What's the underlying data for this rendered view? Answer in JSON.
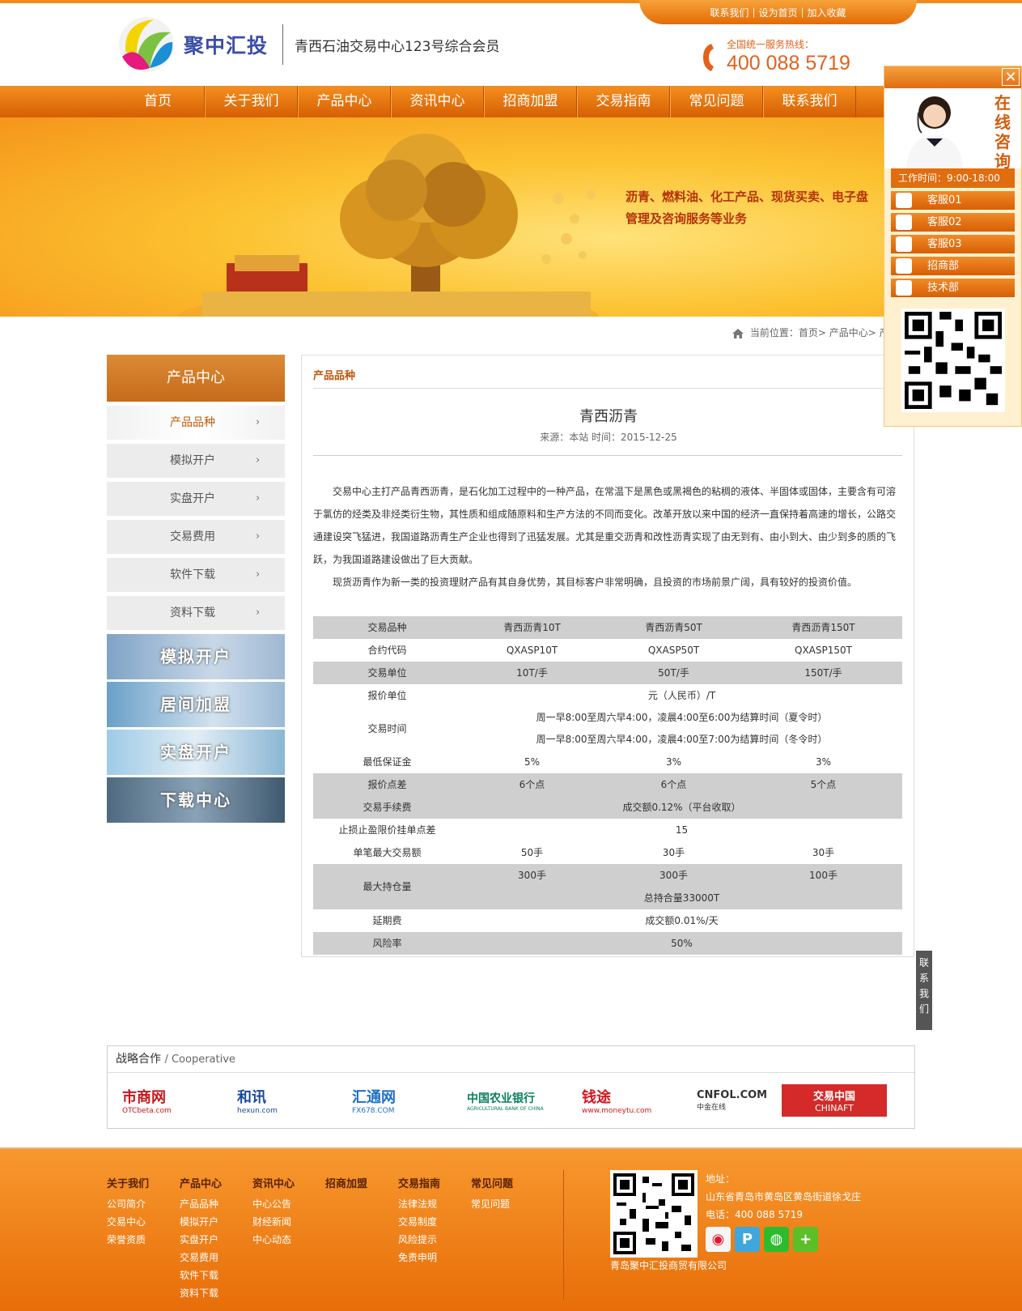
{
  "header": {
    "top_links": [
      "联系我们",
      "设为首页",
      "加入收藏"
    ],
    "brand_name": "聚中汇投",
    "slogan": "青西石油交易中心123号综合会员",
    "hotline_label": "全国统一服务热线：",
    "hotline_number": "400 088 5719"
  },
  "nav": [
    "首页",
    "关于我们",
    "产品中心",
    "资讯中心",
    "招商加盟",
    "交易指南",
    "常见问题",
    "联系我们"
  ],
  "banner": {
    "line1": "沥青、燃料油、化工产品、现货买卖、电子盘",
    "line2": "管理及咨询服务等业务"
  },
  "breadcrumb": "当前位置：首页> 产品中心> 产品品种",
  "sidebar": {
    "title": "产品中心",
    "items": [
      "产品品种",
      "模拟开户",
      "实盘开户",
      "交易费用",
      "软件下载",
      "资料下载"
    ],
    "promos": [
      "模拟开户",
      "居间加盟",
      "实盘开户",
      "下载中心"
    ]
  },
  "article": {
    "category": "产品品种",
    "title": "青西沥青",
    "meta": "来源：本站 时间：2015-12-25",
    "paragraphs": [
      "交易中心主打产品青西沥青，是石化加工过程中的一种产品，在常温下是黑色或黑褐色的粘稠的液体、半固体或固体，主要含有可溶于氯仿的烃类及非烃类衍生物，其性质和组成随原料和生产方法的不同而变化。改革开放以来中国的经济一直保持着高速的增长，公路交通建设突飞猛进，我国道路沥青生产企业也得到了迅猛发展。尤其是重交沥青和改性沥青实现了由无到有、由小到大、由少到多的质的飞跃，为我国道路建设做出了巨大贡献。",
      "现货沥青作为新一类的投资理财产品有其自身优势，其目标客户非常明确，且投资的市场前景广阔，具有较好的投资价值。"
    ]
  },
  "spec_table": {
    "header": [
      "交易品种",
      "青西沥青10T",
      "青西沥青50T",
      "青西沥青150T"
    ],
    "contract_code": [
      "合约代码",
      "QXASP10T",
      "QXASP50T",
      "QXASP150T"
    ],
    "trade_unit": [
      "交易单位",
      "10T/手",
      "50T/手",
      "150T/手"
    ],
    "quote_unit": [
      "报价单位",
      "元（人民币）/T"
    ],
    "trade_time_label": "交易时间",
    "trade_time_summer": "周一早8:00至周六早4:00，凌晨4:00至6:00为结算时间（夏令时）",
    "trade_time_winter": "周一早8:00至周六早4:00，凌晨4:00至7:00为结算时间（冬令时）",
    "min_margin": [
      "最低保证金",
      "5%",
      "3%",
      "3%"
    ],
    "spread": [
      "报价点差",
      "6个点",
      "6个点",
      "5个点"
    ],
    "fee": [
      "交易手续费",
      "成交额0.12%（平台收取）"
    ],
    "stop_points": [
      "止损止盈限价挂单点差",
      "15"
    ],
    "max_single": [
      "单笔最大交易额",
      "50手",
      "30手",
      "30手"
    ],
    "max_position_label": "最大持仓量",
    "max_position": [
      "300手",
      "300手",
      "100手"
    ],
    "max_position_total": "总持合量33000T",
    "overnight": [
      "延期费",
      "成交额0.01%/天"
    ],
    "risk": [
      "风险率",
      "50%"
    ]
  },
  "partners": {
    "title": "战略合作",
    "subtitle": "/ Cooperative",
    "logos": [
      {
        "name": "市商网",
        "sub": "OTCbeta.com",
        "color": "#c8161d"
      },
      {
        "name": "和讯",
        "sub": "hexun.com",
        "color": "#1d4aa0"
      },
      {
        "name": "汇通网",
        "sub": "FX678.COM",
        "color": "#1d6fc7"
      },
      {
        "name": "中国农业银行",
        "sub": "AGRICULTURAL BANK OF CHINA",
        "color": "#0a7f5a"
      },
      {
        "name": "钱途",
        "sub": "www.moneytu.com",
        "color": "#d0191f"
      },
      {
        "name": "CNFOL.COM",
        "sub": "中金在线",
        "color": "#333333"
      },
      {
        "name": "交易中国",
        "sub": "CHINAFT",
        "color": "#ffffff"
      }
    ]
  },
  "footer": {
    "columns": [
      {
        "title": "关于我们",
        "links": [
          "公司简介",
          "交易中心",
          "荣誉资质"
        ]
      },
      {
        "title": "产品中心",
        "links": [
          "产品品种",
          "模拟开户",
          "实盘开户",
          "交易费用",
          "软件下载",
          "资料下载"
        ]
      },
      {
        "title": "资讯中心",
        "links": [
          "中心公告",
          "财经新闻",
          "中心动态"
        ]
      },
      {
        "title": "招商加盟",
        "links": []
      },
      {
        "title": "交易指南",
        "links": [
          "法律法规",
          "交易制度",
          "风险提示",
          "免责申明"
        ]
      },
      {
        "title": "常见问题",
        "links": [
          "常见问题"
        ]
      }
    ],
    "address_label": "地址：",
    "address": "山东省青岛市黄岛区黄岛街道徐戈庄",
    "phone": "电话：400 088 5719",
    "company": "青岛聚中汇投商贸有限公司"
  },
  "float_panel": {
    "vertical_title": "在线咨询",
    "work_time": "工作时间：9:00-18:00",
    "agents": [
      "客服01",
      "客服02",
      "客服03",
      "招商部",
      "技术部"
    ]
  },
  "contact_tab": "联系我们"
}
